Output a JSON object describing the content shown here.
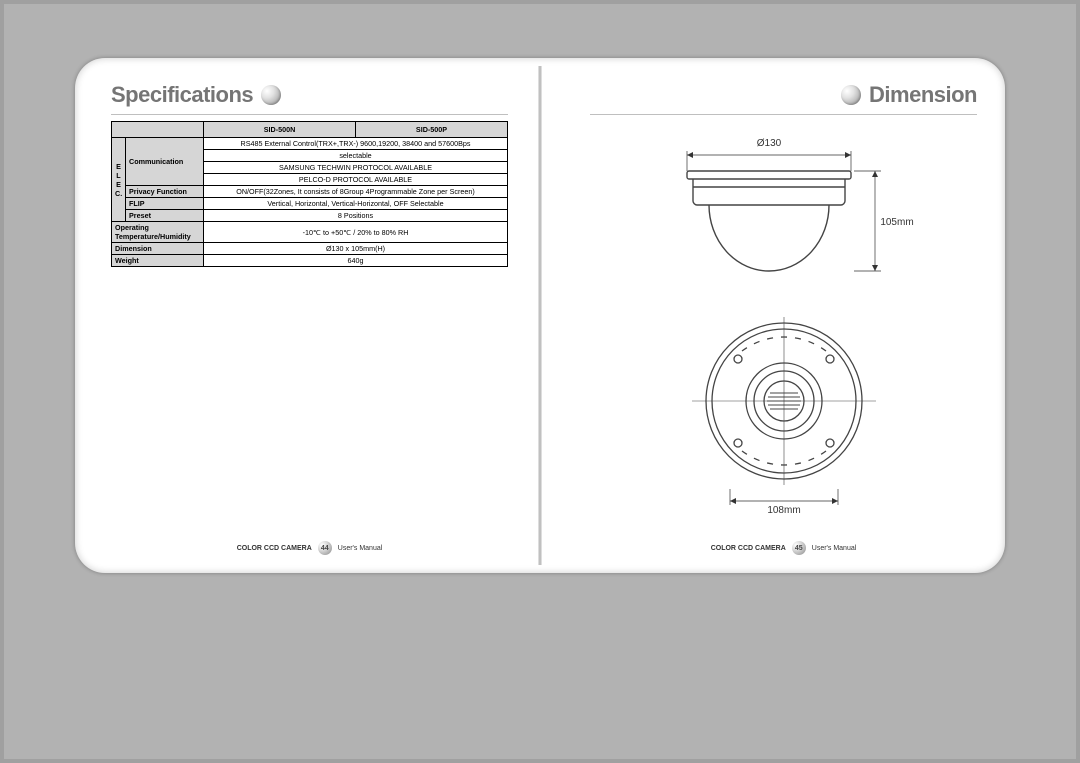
{
  "left": {
    "title": "Specifications",
    "model_a": "SID-500N",
    "model_b": "SID-500P",
    "elec_label": "E L E C.",
    "rows": {
      "communication_label": "Communication",
      "communication_l1": "RS485 External Control(TRX+,TRX-) 9600,19200, 38400 and 57600Bps",
      "communication_l2": "selectable",
      "communication_l3": "SAMSUNG TECHWIN PROTOCOL AVAILABLE",
      "communication_l4": "PELCO-D PROTOCOL AVAILABLE",
      "privacy_label": "Privacy Function",
      "privacy_val": "ON/OFF(32Zones, It consists of 8Group 4Programmable Zone per Screen)",
      "flip_label": "FLIP",
      "flip_val": "Vertical, Horizontal, Vertical-Horizontal, OFF Selectable",
      "preset_label": "Preset",
      "preset_val": "8 Positions",
      "temp_label1": "Operating",
      "temp_label2": "Temperature/Humidity",
      "temp_val": "-10℃ to +50℃  / 20% to 80% RH",
      "dimension_label": "Dimension",
      "dimension_val": "Ø130 x 105mm(H)",
      "weight_label": "Weight",
      "weight_val": "640g"
    },
    "footer_brand": "COLOR CCD CAMERA",
    "footer_page": "44",
    "footer_text": "User's Manual"
  },
  "right": {
    "title": "Dimension",
    "dia": "Ø130",
    "height": "105mm",
    "base": "108mm",
    "footer_brand": "COLOR CCD CAMERA",
    "footer_page": "45",
    "footer_text": "User's Manual"
  }
}
